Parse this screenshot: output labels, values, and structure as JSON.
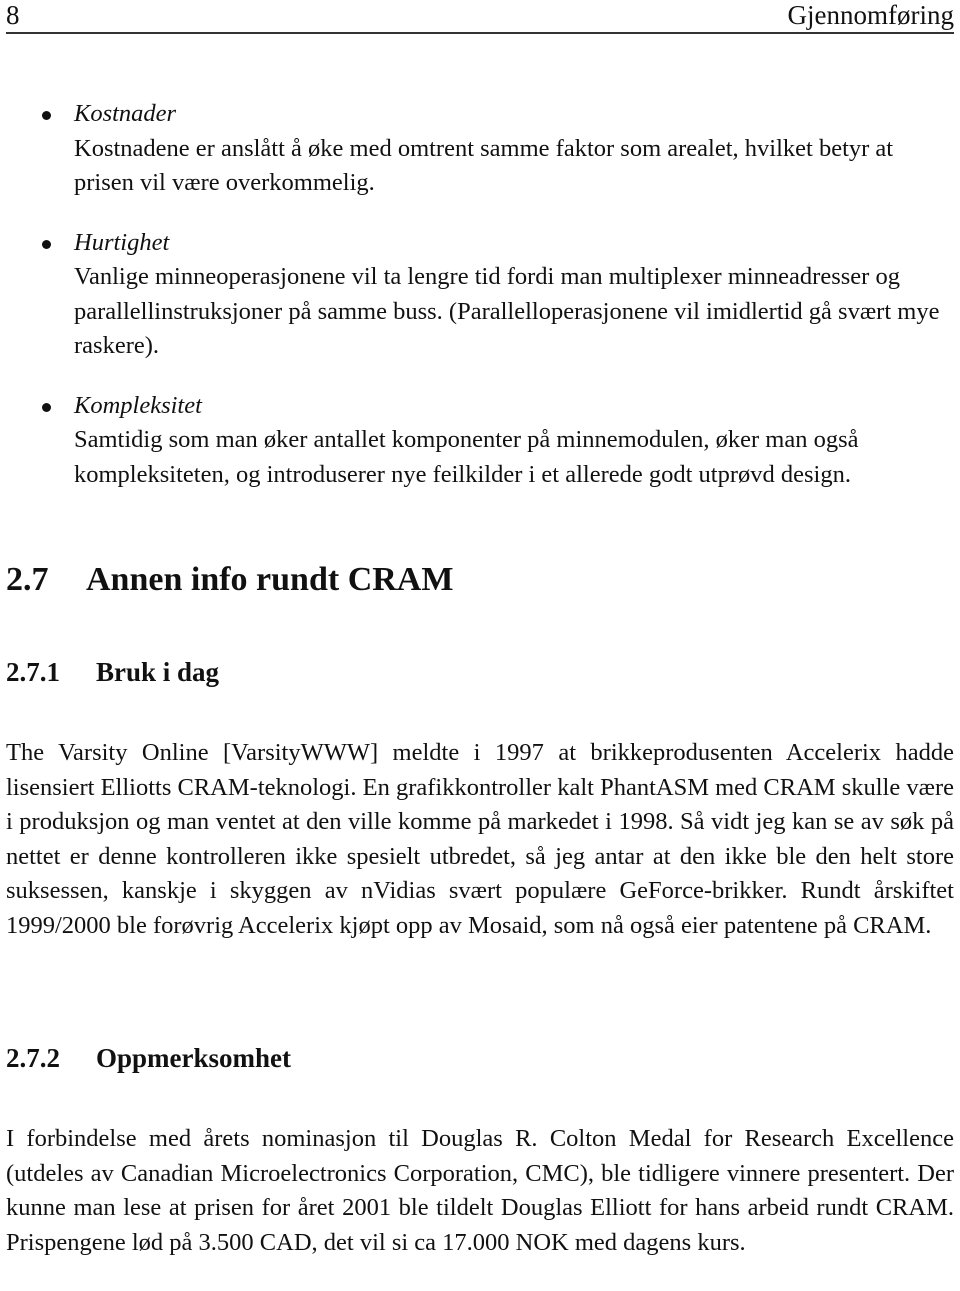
{
  "header": {
    "page_number": "8",
    "chapter_title": "Gjennomføring"
  },
  "bullets": [
    {
      "term": "Kostnader",
      "text": "Kostnadene er anslått å øke med omtrent samme faktor som arealet, hvilket betyr at prisen vil være overkommelig."
    },
    {
      "term": "Hurtighet",
      "text": "Vanlige minneoperasjonene vil ta lengre tid fordi man multiplexer minneadresser og parallellinstruksjoner på samme buss. (Parallelloperasjonene vil imidlertid gå svært mye raskere)."
    },
    {
      "term": "Kompleksitet",
      "text": "Samtidig som man øker antallet komponenter på minnemodulen, øker man også kompleksiteten, og introduserer nye feilkilder i et allerede godt utprøvd design."
    }
  ],
  "section": {
    "number": "2.7",
    "title": "Annen info rundt CRAM"
  },
  "subsections": [
    {
      "number": "2.7.1",
      "title": "Bruk i dag",
      "paragraph": "The Varsity Online [VarsityWWW] meldte i 1997 at brikkeprodusenten Accelerix hadde lisensiert Elliotts CRAM-teknologi. En grafikkontroller kalt PhantASM med CRAM skulle være i produksjon og man ventet at den ville komme på markedet i 1998. Så vidt jeg kan se av søk på nettet er denne kontrolleren ikke spesielt utbredet, så jeg antar at den ikke ble den helt store suksessen, kanskje i skyggen av nVidias svært populære GeForce-brikker. Rundt årskiftet 1999/2000 ble forøvrig Accelerix kjøpt opp av Mosaid, som nå også eier patentene på CRAM."
    },
    {
      "number": "2.7.2",
      "title": "Oppmerksomhet",
      "paragraph": "I forbindelse med årets nominasjon til Douglas R. Colton Medal for Research Excellence (utdeles av Canadian Microelectronics Corporation, CMC), ble tidligere vinnere presentert. Der kunne man lese at prisen for året 2001 ble tildelt Douglas Elliott for hans arbeid rundt CRAM. Prispengene lød på 3.500 CAD, det vil si ca 17.000 NOK med dagens kurs."
    }
  ]
}
